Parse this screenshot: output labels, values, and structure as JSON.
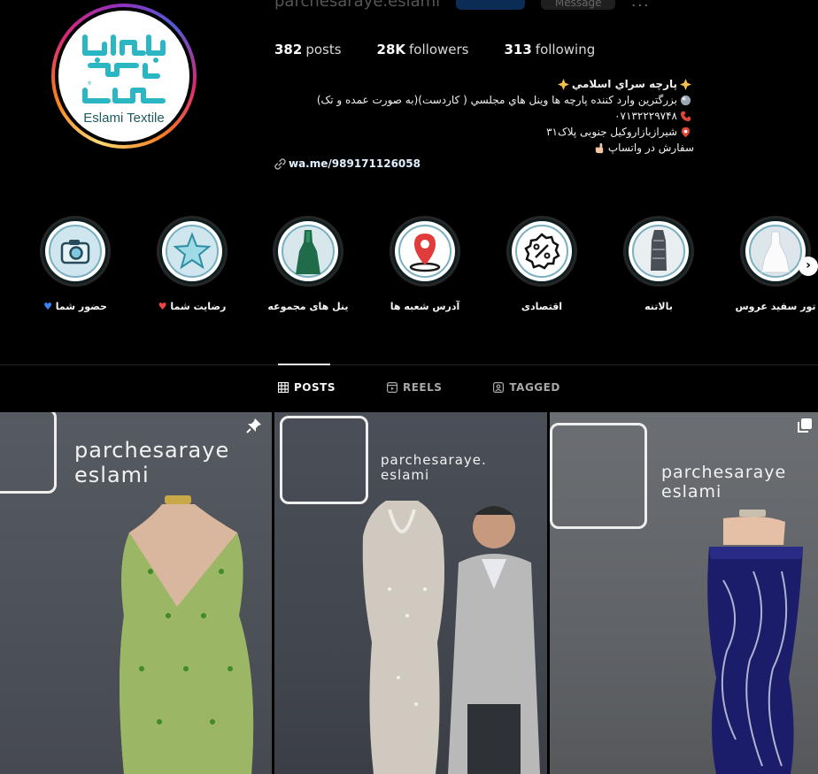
{
  "header": {
    "username": "parchesaraye.eslami",
    "message_label": "Message",
    "more_label": "..."
  },
  "avatar": {
    "caption": "Eslami Textile"
  },
  "stats": {
    "posts_count": "382",
    "posts_label": "posts",
    "followers_count": "28K",
    "followers_label": "followers",
    "following_count": "313",
    "following_label": "following"
  },
  "bio": {
    "name": "پارچه سراي اسلامي",
    "line1": "بزرگترين وارد كننده پارچه ها وينل هاي مجلسي ( كاردست)(به صورت عمده و تک)",
    "phone": "۰۷۱۳۲۲۲۹۷۴۸",
    "address": "شیرازبازاروکیل جنوبی پلاک۳۱",
    "order": "سفارش در واتساپ",
    "link": "wa.me/989171126058"
  },
  "highlights": [
    {
      "label": "حضور شما",
      "icon": "camera-icon"
    },
    {
      "label": "رضایت شما",
      "icon": "star-icon"
    },
    {
      "label": "ینل های مجموعه",
      "icon": "dress-icon"
    },
    {
      "label": "آدرس شعبه ها",
      "icon": "location-pin-icon"
    },
    {
      "label": "اقتصادی",
      "icon": "discount-icon"
    },
    {
      "label": "بالاتنه",
      "icon": "bodice-icon"
    },
    {
      "label": "تور سفید عروس",
      "icon": "wedding-dress-icon"
    }
  ],
  "tabs": [
    {
      "label": "POSTS",
      "icon": "grid-icon",
      "active": true
    },
    {
      "label": "REELS",
      "icon": "reels-icon",
      "active": false
    },
    {
      "label": "TAGGED",
      "icon": "tagged-icon",
      "active": false
    }
  ],
  "posts": [
    {
      "brand_line1": "parchesaraye",
      "brand_line2": "eslami",
      "badge": "pin-icon"
    },
    {
      "brand_line1": "parchesaraye.",
      "brand_line2": "eslami",
      "badge": ""
    },
    {
      "brand_line1": "parchesaraye",
      "brand_line2": "eslami",
      "badge": "multi-photo-icon"
    }
  ],
  "colors": {
    "background": "#000000",
    "accent_blue": "#0095f6",
    "text": "#f5f5f5",
    "muted": "#a8a8a8"
  }
}
